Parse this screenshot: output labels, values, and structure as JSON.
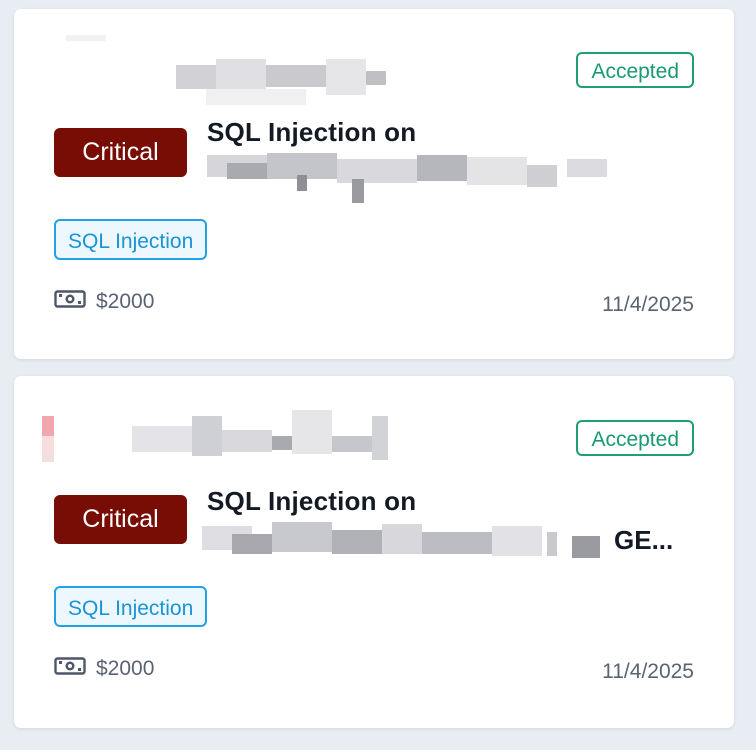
{
  "reports": [
    {
      "status": "Accepted",
      "severity": "Critical",
      "title": "SQL Injection on",
      "title_suffix": "",
      "tag": "SQL Injection",
      "bounty": "$2000",
      "date": "11/4/2025",
      "colors": {
        "status": "#1f9e75",
        "severity": "#770d04",
        "tag": "#22a1e5"
      }
    },
    {
      "status": "Accepted",
      "severity": "Critical",
      "title": "SQL Injection on",
      "title_suffix": "GE...",
      "tag": "SQL Injection",
      "bounty": "$2000",
      "date": "11/4/2025",
      "colors": {
        "status": "#1f9e75",
        "severity": "#770d04",
        "tag": "#22a1e5"
      }
    }
  ],
  "icons": {
    "bounty": "money-bill-icon"
  }
}
